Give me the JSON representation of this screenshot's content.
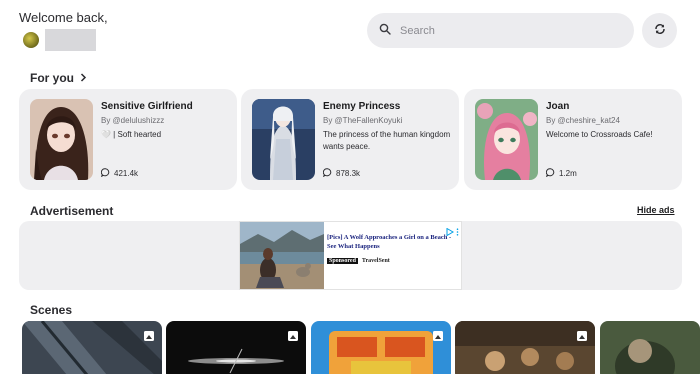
{
  "header": {
    "welcome": "Welcome back,",
    "search_placeholder": "Search"
  },
  "for_you": {
    "title": "For you",
    "cards": [
      {
        "name": "Sensitive Girlfriend",
        "by": "By @delulushizzz",
        "desc": "🤍 | Soft hearted",
        "count": "421.4k"
      },
      {
        "name": "Enemy Princess",
        "by": "By @TheFallenKoyuki",
        "desc": "The princess of the human kingdom wants peace.",
        "count": "878.3k"
      },
      {
        "name": "Joan",
        "by": "By @cheshire_kat24",
        "desc": "Welcome to Crossroads Cafe!",
        "count": "1.2m"
      }
    ]
  },
  "ads": {
    "title": "Advertisement",
    "hide_label": "Hide ads",
    "headline": "[Pics] A Wolf Approaches a Girl on a Beach - See What Happens",
    "sponsored": "Sponsored",
    "advertiser": "TravelSent"
  },
  "scenes": {
    "title": "Scenes"
  },
  "colors": {
    "card_bg": "#efeff1",
    "search_bg": "#ececef",
    "ad_headline": "#1a237e",
    "adchoices": "#00a0e6"
  }
}
